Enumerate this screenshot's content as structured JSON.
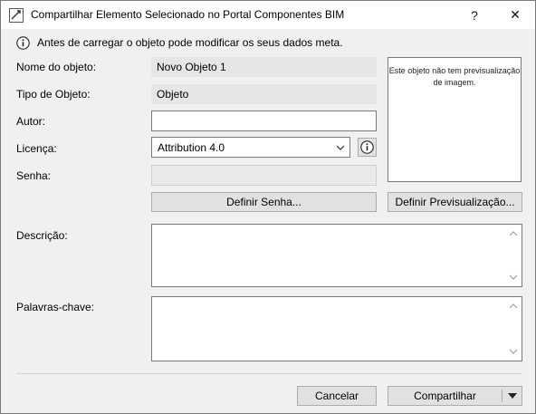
{
  "window": {
    "title": "Compartilhar Elemento Selecionado no Portal Componentes BIM",
    "help_label": "?",
    "close_label": "✕"
  },
  "info": {
    "message": "Antes de carregar o objeto pode modificar os seus dados meta."
  },
  "form": {
    "name_label": "Nome do objeto:",
    "name_value": "Novo Objeto 1",
    "type_label": "Tipo de Objeto:",
    "type_value": "Objeto",
    "author_label": "Autor:",
    "author_value": "",
    "license_label": "Licença:",
    "license_value": "Attribution 4.0",
    "password_label": "Senha:",
    "password_value": "",
    "description_label": "Descrição:",
    "description_value": "",
    "keywords_label": "Palavras-chave:",
    "keywords_value": ""
  },
  "preview": {
    "message": "Este objeto não tem previsualização de imagem."
  },
  "buttons": {
    "set_password": "Definir Senha...",
    "set_preview": "Definir Previsualização...",
    "cancel": "Cancelar",
    "share": "Compartilhar"
  }
}
